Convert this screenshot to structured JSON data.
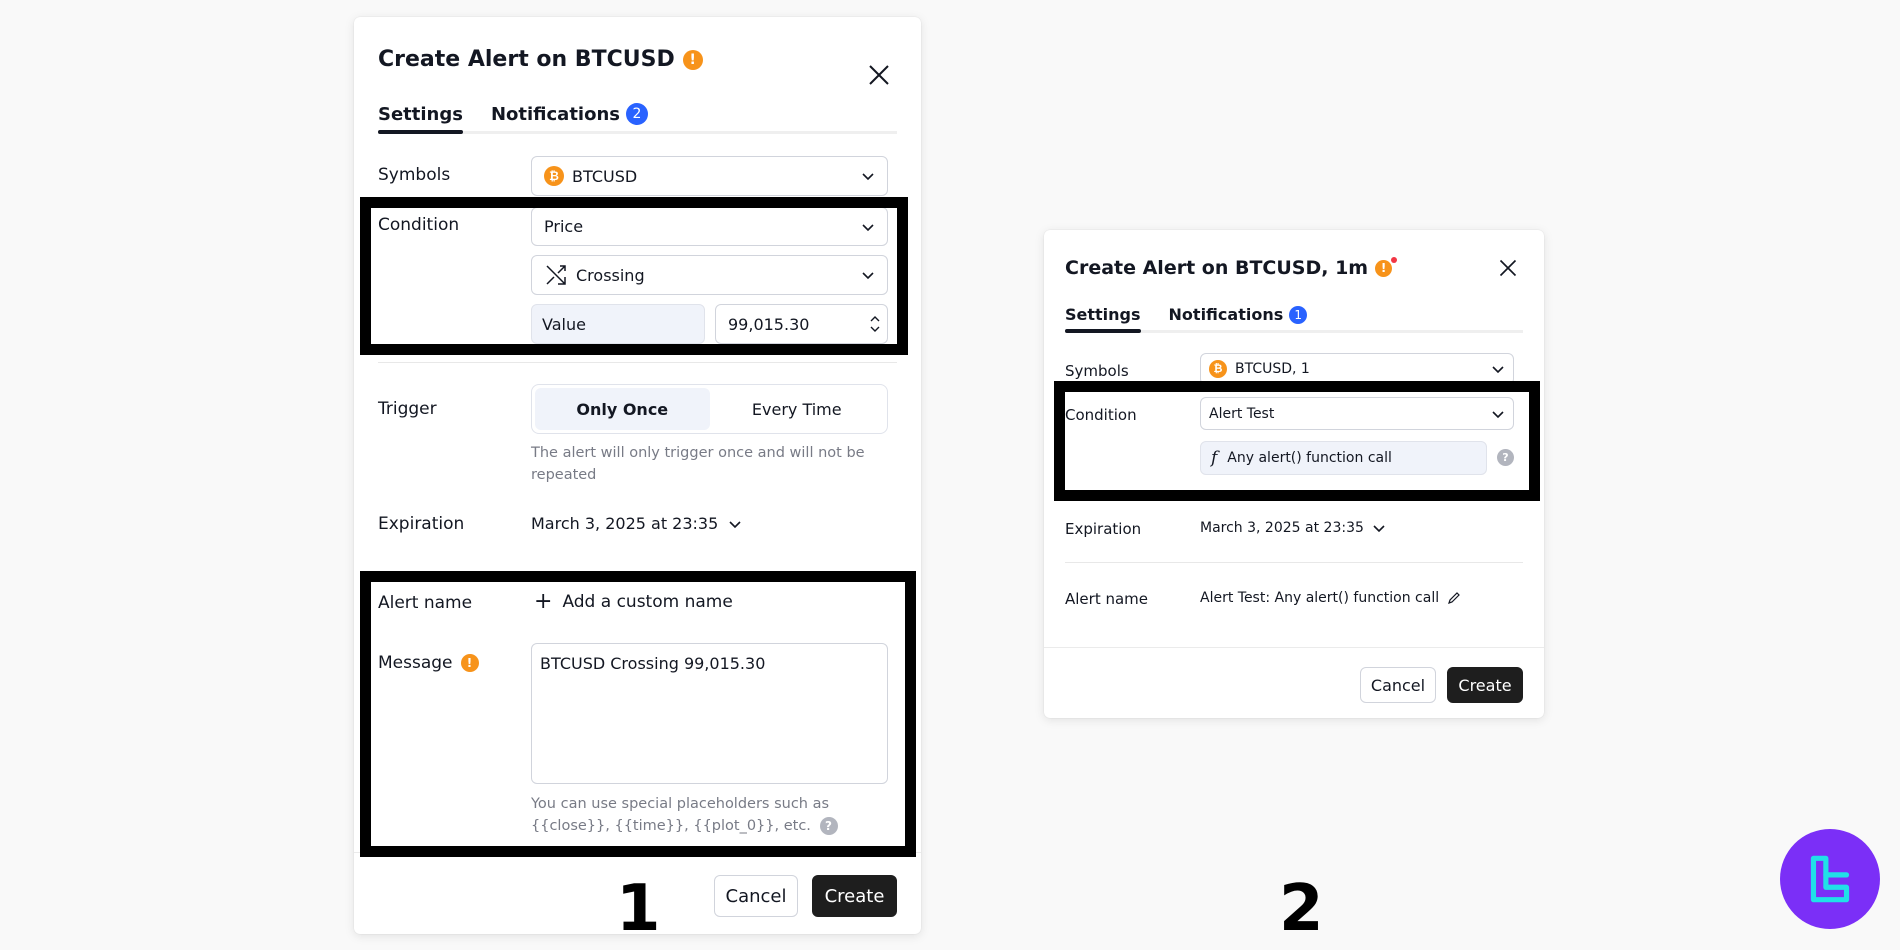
{
  "dialog1": {
    "title": "Create Alert on BTCUSD",
    "tabs": [
      {
        "label": "Settings",
        "active": true
      },
      {
        "label": "Notifications",
        "badge": "2"
      }
    ],
    "symbols_label": "Symbols",
    "symbol_value": "BTCUSD",
    "condition_label": "Condition",
    "condition_source": "Price",
    "condition_operator": "Crossing",
    "value_label": "Value",
    "value": "99,015.30",
    "trigger_label": "Trigger",
    "trigger_options": [
      "Only Once",
      "Every Time"
    ],
    "trigger_selected": "Only Once",
    "trigger_hint": "The alert will only trigger once and will not be repeated",
    "expiration_label": "Expiration",
    "expiration_value": "March 3, 2025 at 23:35",
    "alert_name_label": "Alert name",
    "add_custom_name": "Add a custom name",
    "message_label": "Message",
    "message_value": "BTCUSD Crossing 99,015.30",
    "message_hint": "You can use special placeholders such as {{close}}, {{time}}, {{plot_0}}, etc.",
    "cancel_label": "Cancel",
    "create_label": "Create",
    "caption_number": "1"
  },
  "dialog2": {
    "title": "Create Alert on BTCUSD, 1m",
    "tabs": [
      {
        "label": "Settings",
        "active": true
      },
      {
        "label": "Notifications",
        "badge": "1"
      }
    ],
    "symbols_label": "Symbols",
    "symbol_value": "BTCUSD, 1",
    "condition_label": "Condition",
    "condition_source": "Alert Test",
    "condition_function": "Any alert() function call",
    "expiration_label": "Expiration",
    "expiration_value": "March 3, 2025 at 23:35",
    "alert_name_label": "Alert name",
    "alert_name_value": "Alert Test: Any alert() function call",
    "cancel_label": "Cancel",
    "create_label": "Create",
    "caption_number": "2"
  },
  "icons": {
    "warning": "!",
    "coin": "₿",
    "help": "?",
    "plus": "+",
    "fx": "f"
  },
  "colors": {
    "accent_blue": "#2962ff",
    "warning_orange": "#f7931a",
    "create_button": "#1e1e1e",
    "highlight_box": "#000000",
    "logo_purple": "#7b2ff7",
    "logo_cyan": "#20e0e8"
  }
}
